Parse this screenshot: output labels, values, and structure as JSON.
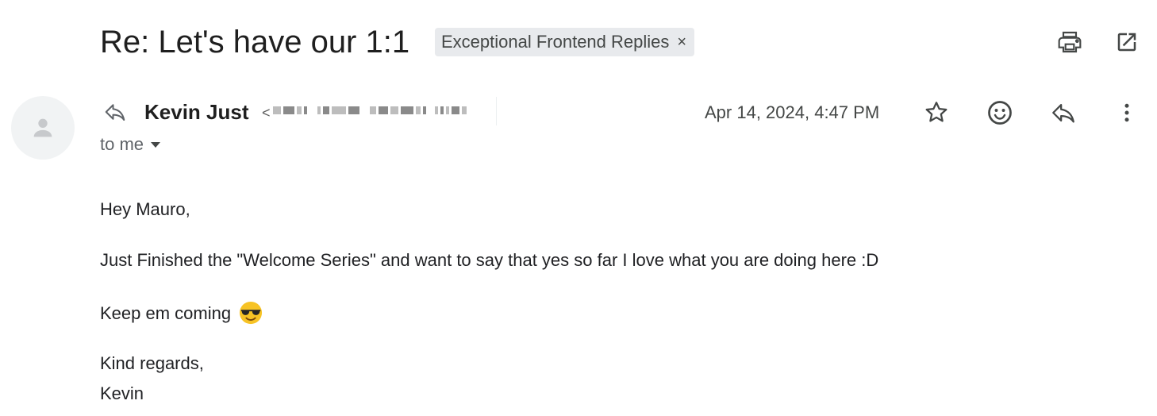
{
  "email": {
    "subject": "Re: Let's have our 1:1",
    "label": "Exceptional Frontend Replies",
    "label_remove": "×",
    "sender": {
      "name": "Kevin Just",
      "email_prefix": "<"
    },
    "recipient_text": "to me",
    "date": "Apr 14, 2024, 4:47 PM",
    "body": {
      "greeting": "Hey Mauro,",
      "line1": "Just Finished the \"Welcome Series\" and want to say that yes so far I love what you are doing here :D",
      "line2": "Keep em coming",
      "closing": "Kind regards,",
      "signature": "Kevin"
    }
  },
  "icons": {
    "print": "print-icon",
    "open_new_window": "open-in-new-window-icon",
    "reply_indicator": "reply-arrow-icon",
    "star": "star-icon",
    "emoji_react": "smiley-icon",
    "reply": "reply-icon",
    "more": "more-vert-icon",
    "avatar": "person-icon",
    "dropdown": "caret-down-icon",
    "body_emoji": "sunglasses-emoji"
  },
  "colors": {
    "label_bg": "#e8eaed",
    "text": "#202124",
    "muted": "#5f6368"
  }
}
